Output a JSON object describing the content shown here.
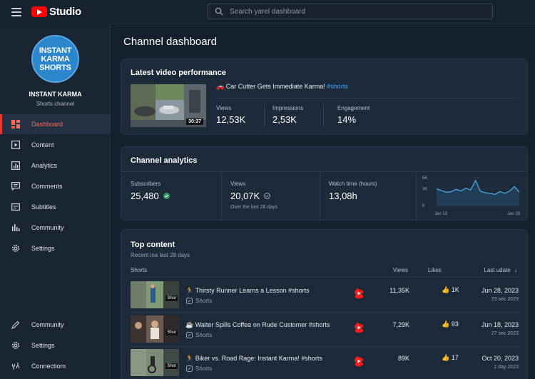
{
  "app": {
    "logo_text": "Studio"
  },
  "search": {
    "placeholder": "Search yarel dashboard"
  },
  "sidebar": {
    "avatar_text": "INSTANT\nKARMA\nSHORTS",
    "channel_name": "INSTANT KARMA",
    "channel_subtitle": "Shorts channel",
    "items": [
      {
        "label": "Dashboard",
        "icon": "dashboard-icon",
        "active": true
      },
      {
        "label": "Content",
        "icon": "content-icon"
      },
      {
        "label": "Analytics",
        "icon": "analytics-icon"
      },
      {
        "label": "Comments",
        "icon": "comments-icon"
      },
      {
        "label": "Subtitles",
        "icon": "subtitles-icon"
      },
      {
        "label": "Community",
        "icon": "community-icon"
      },
      {
        "label": "Settings",
        "icon": "gear-icon"
      }
    ],
    "bottom_items": [
      {
        "label": "Community",
        "icon": "pencil-icon"
      },
      {
        "label": "Settings",
        "icon": "gear-icon"
      },
      {
        "label": "Connectiom",
        "icon": "link-icon"
      }
    ]
  },
  "main": {
    "title": "Channel dashboard",
    "latest": {
      "title": "Latest video performance",
      "video_title": "Car Cutter Gets Immediate Karma!",
      "video_tag": "#shorts",
      "duration": "30:37",
      "metrics": [
        {
          "label": "Views",
          "value": "12,53K"
        },
        {
          "label": "Impressions",
          "value": "2,53K"
        },
        {
          "label": "Engagement",
          "value": "14%"
        }
      ]
    },
    "analytics": {
      "title": "Channel analytics",
      "subscribers_label": "Subscribers",
      "subscribers_value": "25,480",
      "views_label": "Views",
      "views_value": "20,07K",
      "views_note": "Over the last 28 days",
      "watch_label": "Watch time (hours)",
      "watch_value": "13,08h",
      "spark": {
        "y_ticks": [
          "5K",
          "3K",
          "0"
        ],
        "x_ticks": [
          "Jan 13",
          "Jan 28"
        ],
        "values": [
          3.0,
          2.7,
          2.4,
          2.5,
          2.9,
          2.6,
          3.1,
          2.8,
          4.5,
          2.6,
          2.3,
          2.2,
          2.0,
          2.5,
          2.2,
          2.6,
          3.4,
          2.4
        ]
      }
    },
    "top": {
      "title": "Top content",
      "subtitle": "Recent ina last 28 days",
      "col_shorts": "Shorts",
      "col_views": "Views",
      "col_likes": "Likes",
      "col_date": "Last udate",
      "thumb_label": "Shor",
      "rows": [
        {
          "title": "Thirsty Runner Learns a Lesson #shorts",
          "sub": "Shorts",
          "views": "11,35K",
          "likes": "1K",
          "date": "Jun 28, 2023",
          "date2": "23 sec 2023"
        },
        {
          "title": "Waiter Spills Coffee on Rude Customer #shorts",
          "sub": "Shorts",
          "views": "7,29K",
          "likes": "93",
          "date": "Jun 18, 2023",
          "date2": "27 sec 2023"
        },
        {
          "title": "Biker vs. Road Rage: Instant Karma! #shorts",
          "sub": "Shorts",
          "views": "89K",
          "likes": "17",
          "date": "Oct 20, 2023",
          "date2": "1 day 2023"
        }
      ]
    }
  }
}
